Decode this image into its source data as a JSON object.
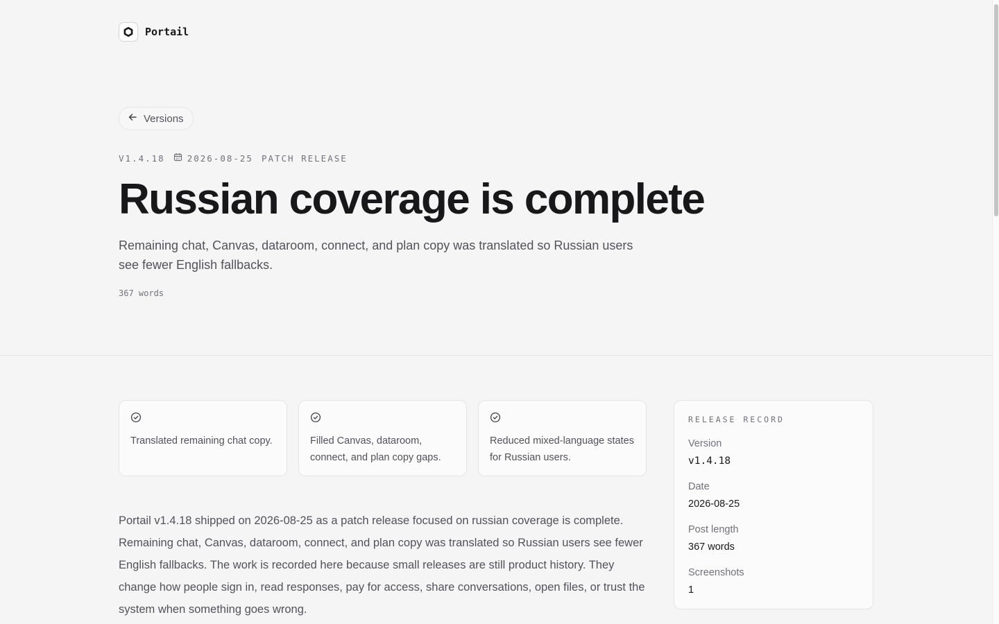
{
  "brand": {
    "name": "Portail",
    "icon": "portail-logo-icon"
  },
  "nav": {
    "back_label": "Versions",
    "back_icon": "arrow-left-icon"
  },
  "release": {
    "version_tag": "v1.4.18",
    "date": "2026-08-25",
    "date_icon": "calendar-icon",
    "type": "Patch release",
    "title": "Russian coverage is complete",
    "subtitle": "Remaining chat, Canvas, dataroom, connect, and plan copy was translated so Russian users see fewer English fallbacks.",
    "word_count": "367 words"
  },
  "highlights": [
    {
      "icon": "check-circle-icon",
      "text": "Translated remaining chat copy."
    },
    {
      "icon": "check-circle-icon",
      "text": "Filled Canvas, dataroom, connect, and plan copy gaps."
    },
    {
      "icon": "check-circle-icon",
      "text": "Reduced mixed-language states for Russian users."
    }
  ],
  "body": "Portail v1.4.18 shipped on 2026-08-25 as a patch release focused on russian coverage is complete. Remaining chat, Canvas, dataroom, connect, and plan copy was translated so Russian users see fewer English fallbacks. The work is recorded here because small releases are still product history. They change how people sign in, read responses, pay for access, share conversations, open files, or trust the system when something goes wrong.",
  "record": {
    "heading": "Release record",
    "items": [
      {
        "label": "Version",
        "value": "v1.4.18"
      },
      {
        "label": "Date",
        "value": "2026-08-25"
      },
      {
        "label": "Post length",
        "value": "367 words"
      },
      {
        "label": "Screenshots",
        "value": "1"
      }
    ]
  },
  "colors": {
    "background": "#f5f5f5",
    "text": "#18181b",
    "muted": "#52525b",
    "border": "#e4e4e7"
  }
}
